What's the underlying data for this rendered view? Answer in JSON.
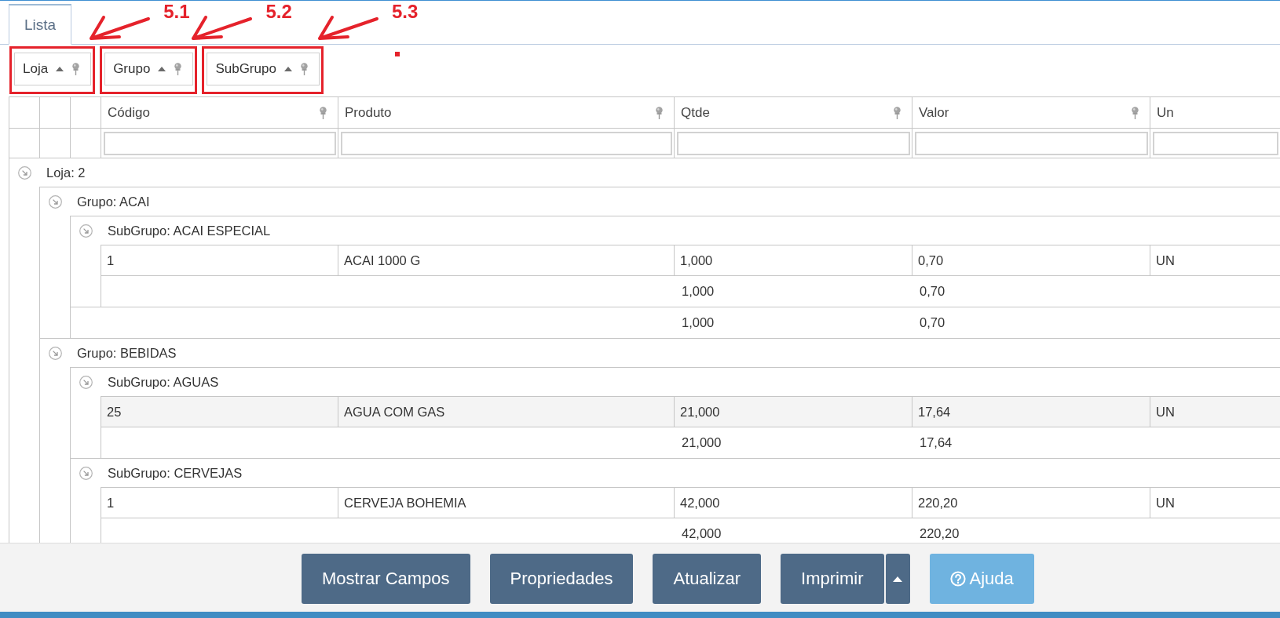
{
  "tabs": [
    {
      "label": "Lista",
      "selected": true
    }
  ],
  "group_by": [
    {
      "label": "Loja",
      "ascending": true,
      "annotation": {
        "label": "5.1",
        "dot": false
      }
    },
    {
      "label": "Grupo",
      "ascending": true,
      "annotation": {
        "label": "5.2",
        "dot": false
      }
    },
    {
      "label": "SubGrupo",
      "ascending": true,
      "annotation": {
        "label": "5.3",
        "dot": true
      }
    }
  ],
  "table": {
    "columns": [
      {
        "label": "Código",
        "pin": true
      },
      {
        "label": "Produto",
        "pin": true
      },
      {
        "label": "Qtde",
        "pin": true
      },
      {
        "label": "Valor",
        "pin": true
      },
      {
        "label": "Un",
        "pin": false
      }
    ],
    "groups": [
      {
        "label": "Loja: 2",
        "expanded": true,
        "children": [
          {
            "label": "Grupo: ACAI",
            "expanded": true,
            "children": [
              {
                "label": "SubGrupo: ACAI ESPECIAL",
                "expanded": true,
                "rows": [
                  {
                    "cells": [
                      "1",
                      "ACAI 1000 G",
                      "1,000",
                      "0,70",
                      "UN"
                    ],
                    "selected": false
                  }
                ],
                "totals": {
                  "qtde": "1,000",
                  "valor": "0,70"
                }
              }
            ],
            "totals": {
              "qtde": "1,000",
              "valor": "0,70"
            }
          },
          {
            "label": "Grupo: BEBIDAS",
            "expanded": true,
            "children": [
              {
                "label": "SubGrupo: AGUAS",
                "expanded": true,
                "rows": [
                  {
                    "cells": [
                      "25",
                      "AGUA COM GAS",
                      "21,000",
                      "17,64",
                      "UN"
                    ],
                    "selected": true
                  }
                ],
                "totals": {
                  "qtde": "21,000",
                  "valor": "17,64"
                }
              },
              {
                "label": "SubGrupo: CERVEJAS",
                "expanded": true,
                "rows": [
                  {
                    "cells": [
                      "1",
                      "CERVEJA BOHEMIA",
                      "42,000",
                      "220,20",
                      "UN"
                    ],
                    "selected": false
                  }
                ],
                "totals": {
                  "qtde": "42,000",
                  "valor": "220,20"
                }
              }
            ]
          }
        ]
      }
    ]
  },
  "buttons": [
    {
      "label": "Mostrar Campos",
      "kind": "plain"
    },
    {
      "label": "Propriedades",
      "kind": "plain"
    },
    {
      "label": "Atualizar",
      "kind": "plain"
    },
    {
      "label": "Imprimir",
      "kind": "split"
    },
    {
      "label": "Ajuda",
      "kind": "help"
    }
  ]
}
